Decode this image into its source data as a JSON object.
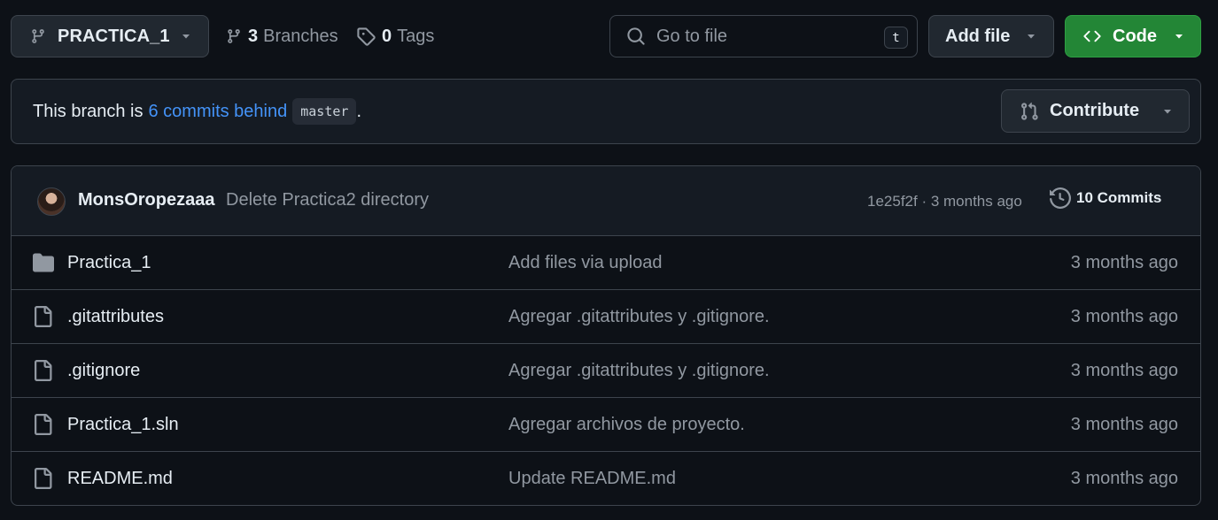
{
  "toolbar": {
    "branch": "PRACTICA_1",
    "branches_count": "3",
    "branches_label": "Branches",
    "tags_count": "0",
    "tags_label": "Tags",
    "search_placeholder": "Go to file",
    "search_shortcut": "t",
    "add_file_label": "Add file",
    "code_label": "Code"
  },
  "banner": {
    "prefix": "This branch is",
    "link": "6 commits behind",
    "branch": "master",
    "suffix": ".",
    "contribute_label": "Contribute"
  },
  "latest_commit": {
    "author": "MonsOropezaaa",
    "message": "Delete Practica2 directory",
    "meta": "1e25f2f · 3 months ago",
    "commits_label": "10 Commits"
  },
  "files": [
    {
      "name": "Practica_1",
      "type": "folder",
      "message": "Add files via upload",
      "time": "3 months ago"
    },
    {
      "name": ".gitattributes",
      "type": "file",
      "message": "Agregar .gitattributes y .gitignore.",
      "time": "3 months ago"
    },
    {
      "name": ".gitignore",
      "type": "file",
      "message": "Agregar .gitattributes y .gitignore.",
      "time": "3 months ago"
    },
    {
      "name": "Practica_1.sln",
      "type": "file",
      "message": "Agregar archivos de proyecto.",
      "time": "3 months ago"
    },
    {
      "name": "README.md",
      "type": "file",
      "message": "Update README.md",
      "time": "3 months ago"
    }
  ],
  "colors": {
    "background": "#0d1117",
    "border": "#3d444d",
    "link": "#4493f8",
    "primary_button": "#238636",
    "muted_text": "#9198a1"
  },
  "icons": {
    "branch": "git-branch-icon",
    "tag": "tag-icon",
    "search": "search-icon",
    "code": "code-icon",
    "contribute": "git-pull-request-icon",
    "history": "history-icon",
    "folder": "folder-icon",
    "file": "file-icon"
  }
}
